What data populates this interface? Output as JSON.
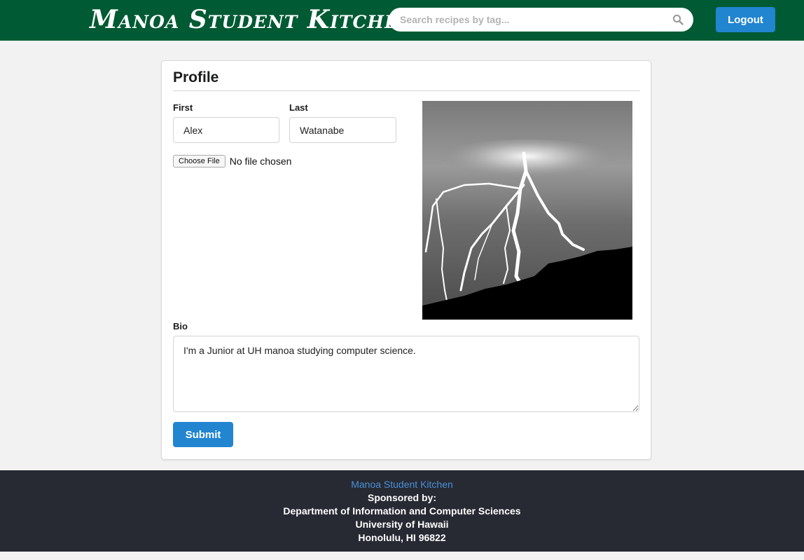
{
  "header": {
    "brand": "Manoa Student Kitchen",
    "search_placeholder": "Search recipes by tag...",
    "logout_label": "Logout"
  },
  "profile": {
    "title": "Profile",
    "first_label": "First",
    "first_value": "Alex",
    "last_label": "Last",
    "last_value": "Watanabe",
    "choose_file_label": "Choose File",
    "no_file_text": "No file chosen",
    "bio_label": "Bio",
    "bio_value": "I'm a Junior at UH manoa studying computer science.",
    "submit_label": "Submit"
  },
  "footer": {
    "site_link": "Manoa Student Kitchen",
    "sponsored": "Sponsored by:",
    "department": "Department of Information and Computer Sciences",
    "university": "University of Hawaii",
    "address": "Honolulu, HI 96822"
  },
  "colors": {
    "header_green": "#005a33",
    "primary_blue": "#2185d0",
    "footer_dark": "#272a33"
  }
}
